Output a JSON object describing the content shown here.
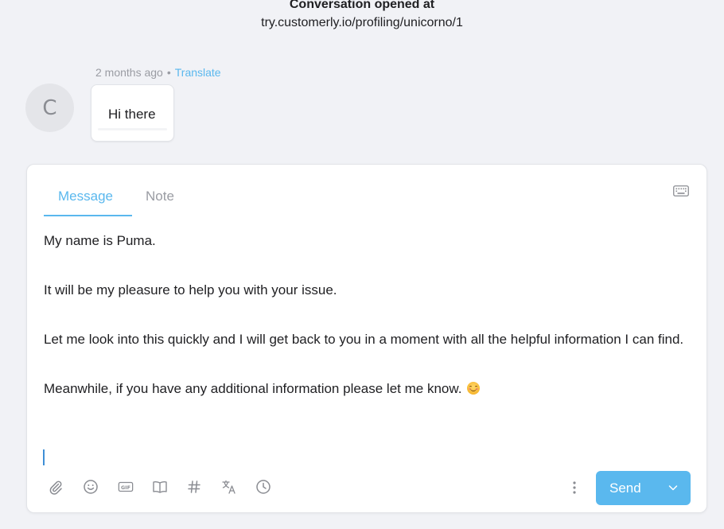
{
  "header": {
    "title": "Conversation opened at",
    "url": "try.customerly.io/profiling/unicorno/1"
  },
  "message": {
    "avatar_initial": "C",
    "time": "2 months ago",
    "separator": "•",
    "translate_label": "Translate",
    "text": "Hi there"
  },
  "composer": {
    "tabs": [
      {
        "label": "Message",
        "active": true
      },
      {
        "label": "Note",
        "active": false
      }
    ],
    "body": [
      "My name is Puma.",
      "It will be my pleasure to help you with your issue.",
      "Let me look into this quickly and I will get back to you in a moment with all the helpful information I can find.",
      "Meanwhile, if you have any additional information please let me know."
    ],
    "body_emoji": "smiling-face-emoji",
    "toolbar_icons": [
      "attachment-icon",
      "emoji-icon",
      "gif-icon",
      "knowledge-base-icon",
      "hashtag-icon",
      "translate-icon",
      "schedule-icon"
    ],
    "gif_label": "GIF",
    "send_label": "Send"
  },
  "colors": {
    "accent": "#5ab8ee",
    "background": "#f1f2f6",
    "text": "#1f1f22",
    "muted": "#9a9ca3"
  }
}
